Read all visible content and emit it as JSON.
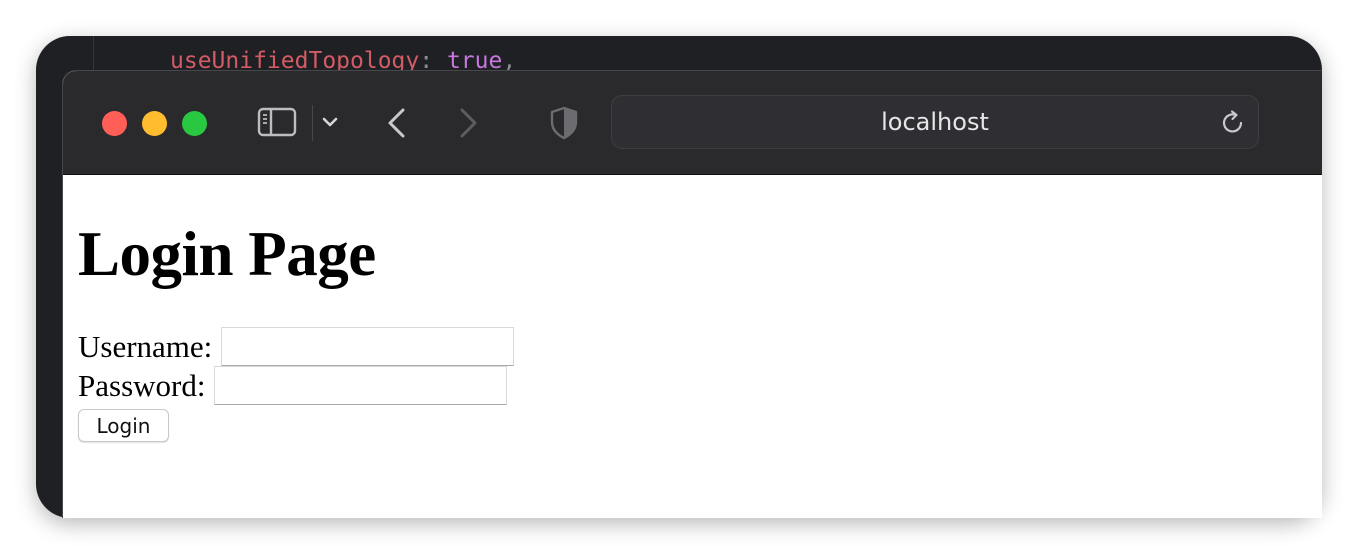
{
  "editor": {
    "code_line": {
      "property": "useUnifiedTopology",
      "separator": ": ",
      "value": "true",
      "trailing": ","
    }
  },
  "browser": {
    "address": "localhost",
    "icons": {
      "sidebar": "sidebar-icon",
      "tab_overview": "chevron-down-icon",
      "back": "back-icon",
      "forward": "forward-icon",
      "privacy": "shield-icon",
      "reload": "reload-icon"
    }
  },
  "page": {
    "title": "Login Page",
    "username_label": "Username:",
    "username_value": "",
    "password_label": "Password:",
    "password_value": "",
    "login_button": "Login"
  },
  "colors": {
    "close": "#ff5f57",
    "minimize": "#febc2e",
    "zoom": "#28c840",
    "toolbar": "#2a2a2d"
  }
}
